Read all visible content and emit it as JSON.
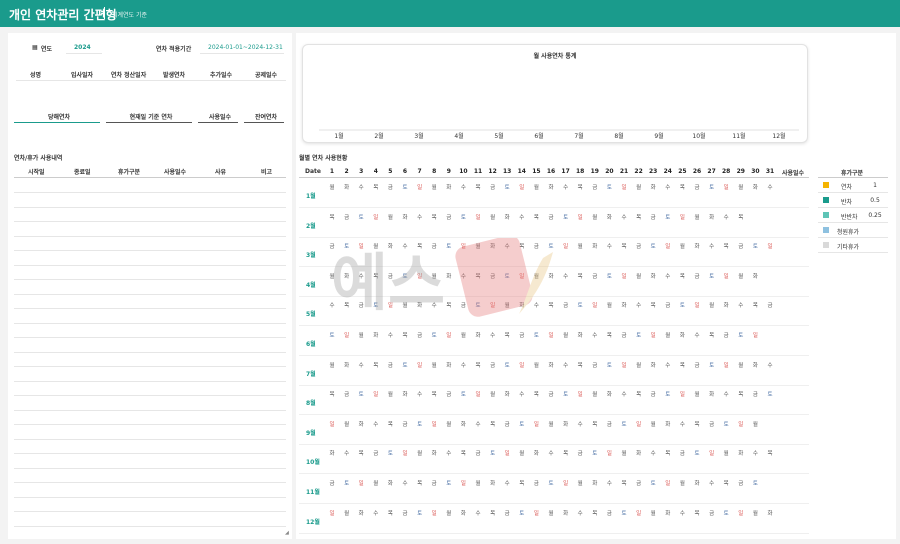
{
  "header": {
    "title": "개인 연차관리 간편형",
    "subtitle": "회계연도 기준"
  },
  "settings": {
    "year_label": "연도",
    "year_value": "2024",
    "period_label": "연차 적용기간",
    "period_value": "2024-01-01~2024-12-31"
  },
  "info_table": {
    "headers": [
      "성명",
      "입사일자",
      "연차 정산일자",
      "발생연차",
      "추가일수",
      "공제일수"
    ]
  },
  "summary": {
    "labels": [
      "당해연차",
      "현재일 기준 연차",
      "사용일수",
      "잔여연차"
    ]
  },
  "usage_list": {
    "title": "연차/휴가 사용내역",
    "headers": [
      "시작일",
      "종료일",
      "휴가구분",
      "사용일수",
      "사유",
      "비고"
    ]
  },
  "chart_data": {
    "type": "bar",
    "title": "월 사용연차 통계",
    "categories": [
      "1월",
      "2월",
      "3월",
      "4월",
      "5월",
      "6월",
      "7월",
      "8월",
      "9월",
      "10월",
      "11월",
      "12월"
    ],
    "values": [
      0,
      0,
      0,
      0,
      0,
      0,
      0,
      0,
      0,
      0,
      0,
      0
    ],
    "xlabel": "",
    "ylabel": ""
  },
  "calendar": {
    "title": "월별 연차 사용현황",
    "date_header": "Date",
    "usage_header": "사용일수",
    "months": [
      {
        "label": "1월",
        "days": [
          "월",
          "화",
          "수",
          "목",
          "금",
          "토",
          "일",
          "월",
          "화",
          "수",
          "목",
          "금",
          "토",
          "일",
          "월",
          "화",
          "수",
          "목",
          "금",
          "토",
          "일",
          "월",
          "화",
          "수",
          "목",
          "금",
          "토",
          "일",
          "월",
          "화",
          "수"
        ]
      },
      {
        "label": "2월",
        "days": [
          "목",
          "금",
          "토",
          "일",
          "월",
          "화",
          "수",
          "목",
          "금",
          "토",
          "일",
          "월",
          "화",
          "수",
          "목",
          "금",
          "토",
          "일",
          "월",
          "화",
          "수",
          "목",
          "금",
          "토",
          "일",
          "월",
          "화",
          "수",
          "목"
        ]
      },
      {
        "label": "3월",
        "days": [
          "금",
          "토",
          "일",
          "월",
          "화",
          "수",
          "목",
          "금",
          "토",
          "일",
          "월",
          "화",
          "수",
          "목",
          "금",
          "토",
          "일",
          "월",
          "화",
          "수",
          "목",
          "금",
          "토",
          "일",
          "월",
          "화",
          "수",
          "목",
          "금",
          "토",
          "일"
        ]
      },
      {
        "label": "4월",
        "days": [
          "월",
          "화",
          "수",
          "목",
          "금",
          "토",
          "일",
          "월",
          "화",
          "수",
          "목",
          "금",
          "토",
          "일",
          "월",
          "화",
          "수",
          "목",
          "금",
          "토",
          "일",
          "월",
          "화",
          "수",
          "목",
          "금",
          "토",
          "일",
          "월",
          "화"
        ]
      },
      {
        "label": "5월",
        "days": [
          "수",
          "목",
          "금",
          "토",
          "일",
          "월",
          "화",
          "수",
          "목",
          "금",
          "토",
          "일",
          "월",
          "화",
          "수",
          "목",
          "금",
          "토",
          "일",
          "월",
          "화",
          "수",
          "목",
          "금",
          "토",
          "일",
          "월",
          "화",
          "수",
          "목",
          "금"
        ]
      },
      {
        "label": "6월",
        "days": [
          "토",
          "일",
          "월",
          "화",
          "수",
          "목",
          "금",
          "토",
          "일",
          "월",
          "화",
          "수",
          "목",
          "금",
          "토",
          "일",
          "월",
          "화",
          "수",
          "목",
          "금",
          "토",
          "일",
          "월",
          "화",
          "수",
          "목",
          "금",
          "토",
          "일"
        ]
      },
      {
        "label": "7월",
        "days": [
          "월",
          "화",
          "수",
          "목",
          "금",
          "토",
          "일",
          "월",
          "화",
          "수",
          "목",
          "금",
          "토",
          "일",
          "월",
          "화",
          "수",
          "목",
          "금",
          "토",
          "일",
          "월",
          "화",
          "수",
          "목",
          "금",
          "토",
          "일",
          "월",
          "화",
          "수"
        ]
      },
      {
        "label": "8월",
        "days": [
          "목",
          "금",
          "토",
          "일",
          "월",
          "화",
          "수",
          "목",
          "금",
          "토",
          "일",
          "월",
          "화",
          "수",
          "목",
          "금",
          "토",
          "일",
          "월",
          "화",
          "수",
          "목",
          "금",
          "토",
          "일",
          "월",
          "화",
          "수",
          "목",
          "금",
          "토"
        ]
      },
      {
        "label": "9월",
        "days": [
          "일",
          "월",
          "화",
          "수",
          "목",
          "금",
          "토",
          "일",
          "월",
          "화",
          "수",
          "목",
          "금",
          "토",
          "일",
          "월",
          "화",
          "수",
          "목",
          "금",
          "토",
          "일",
          "월",
          "화",
          "수",
          "목",
          "금",
          "토",
          "일",
          "월"
        ]
      },
      {
        "label": "10월",
        "days": [
          "화",
          "수",
          "목",
          "금",
          "토",
          "일",
          "월",
          "화",
          "수",
          "목",
          "금",
          "토",
          "일",
          "월",
          "화",
          "수",
          "목",
          "금",
          "토",
          "일",
          "월",
          "화",
          "수",
          "목",
          "금",
          "토",
          "일",
          "월",
          "화",
          "수",
          "목"
        ]
      },
      {
        "label": "11월",
        "days": [
          "금",
          "토",
          "일",
          "월",
          "화",
          "수",
          "목",
          "금",
          "토",
          "일",
          "월",
          "화",
          "수",
          "목",
          "금",
          "토",
          "일",
          "월",
          "화",
          "수",
          "목",
          "금",
          "토",
          "일",
          "월",
          "화",
          "수",
          "목",
          "금",
          "토"
        ]
      },
      {
        "label": "12월",
        "days": [
          "일",
          "월",
          "화",
          "수",
          "목",
          "금",
          "토",
          "일",
          "월",
          "화",
          "수",
          "목",
          "금",
          "토",
          "일",
          "월",
          "화",
          "수",
          "목",
          "금",
          "토",
          "일",
          "월",
          "화",
          "수",
          "목",
          "금",
          "토",
          "일",
          "월",
          "화"
        ]
      }
    ]
  },
  "leave_types": {
    "title": "휴가구분",
    "items": [
      {
        "name": "연차",
        "value": "1",
        "color": "#f5b400"
      },
      {
        "name": "반차",
        "value": "0.5",
        "color": "#1a9b8c"
      },
      {
        "name": "반반차",
        "value": "0.25",
        "color": "#5ec4b6"
      },
      {
        "name": "청원휴가",
        "value": "",
        "color": "#8ec1e0"
      },
      {
        "name": "기타휴가",
        "value": "",
        "color": "#d9d9d9"
      }
    ]
  },
  "colors": {
    "brand": "#1a9b8c",
    "weekend": "#4a6fa5",
    "holiday": "#d9534f"
  }
}
